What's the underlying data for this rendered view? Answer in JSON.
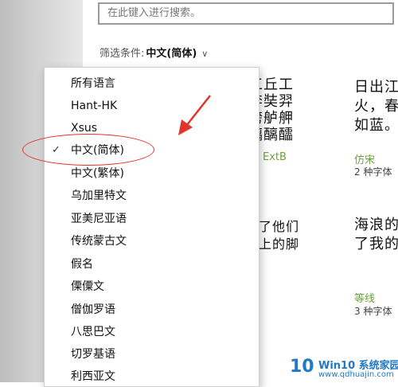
{
  "search": {
    "placeholder": "在此键入进行搜索。"
  },
  "filter": {
    "label": "筛选条件:",
    "value": "中文(简体)"
  },
  "cards": [
    {
      "sample_lines": [
        "工丘工",
        "奔奘羿",
        "舿舻舺",
        "醨醨醽"
      ],
      "name": "ExtB",
      "count": ""
    },
    {
      "sample_lines": [
        "日出江",
        "火，春",
        "如蓝。"
      ],
      "name": "仿宋",
      "count": "2 种字体"
    },
    {
      "sample_lines": [
        "淡了他们",
        "滩上的脚"
      ],
      "name": "",
      "count": ""
    },
    {
      "sample_lines": [
        "海浪的",
        "了我的"
      ],
      "name": "等线",
      "count": "3 种字体"
    }
  ],
  "dropdown": {
    "items": [
      {
        "label": "所有语言",
        "checked": false
      },
      {
        "label": "Hant-HK",
        "checked": false
      },
      {
        "label": "Xsus",
        "checked": false
      },
      {
        "label": "中文(简体)",
        "checked": true
      },
      {
        "label": "中文(繁体)",
        "checked": false
      },
      {
        "label": "乌加里特文",
        "checked": false
      },
      {
        "label": "亚美尼亚语",
        "checked": false
      },
      {
        "label": "传统蒙古文",
        "checked": false
      },
      {
        "label": "假名",
        "checked": false
      },
      {
        "label": "傈僳文",
        "checked": false
      },
      {
        "label": "僧伽罗语",
        "checked": false
      },
      {
        "label": "八思巴文",
        "checked": false
      },
      {
        "label": "切罗基语",
        "checked": false
      },
      {
        "label": "利西亚文",
        "checked": false
      }
    ],
    "check_glyph": "✓"
  },
  "annotation": {
    "color": "#e0342c"
  },
  "watermark": {
    "logo": "10",
    "title": "Win10 系统家园",
    "url": "www.qdhuajin.com"
  }
}
